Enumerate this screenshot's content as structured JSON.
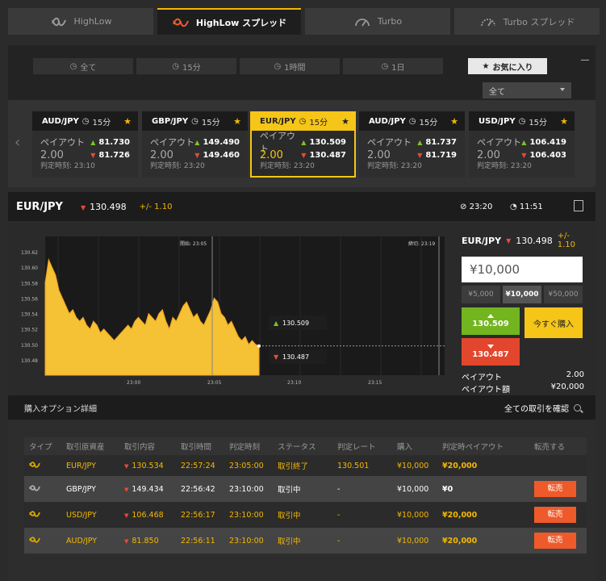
{
  "product_tabs": [
    {
      "label": "HighLow",
      "icon": "highlow-icon"
    },
    {
      "label": "HighLow スプレッド",
      "icon": "highlow-spread-icon"
    },
    {
      "label": "Turbo",
      "icon": "turbo-gauge-icon"
    },
    {
      "label": "Turbo スプレッド",
      "icon": "turbo-spread-gauge-icon"
    }
  ],
  "filter_tabs": [
    "全て",
    "15分",
    "1時間",
    "1日",
    "お気に入り"
  ],
  "filter_select": "全て",
  "cards": [
    {
      "pair": "AUD/JPY",
      "period": "15分",
      "payout_label": "ペイアウト",
      "payout": "2.00",
      "high": "81.730",
      "low": "81.726",
      "time_label": "判定時刻: 23:10"
    },
    {
      "pair": "GBP/JPY",
      "period": "15分",
      "payout_label": "ペイアウト",
      "payout": "2.00",
      "high": "149.490",
      "low": "149.460",
      "time_label": "判定時刻: 23:20"
    },
    {
      "pair": "EUR/JPY",
      "period": "15分",
      "payout_label": "ペイアウト",
      "payout": "2.00",
      "high": "130.509",
      "low": "130.487",
      "time_label": "判定時刻: 23:20"
    },
    {
      "pair": "AUD/JPY",
      "period": "15分",
      "payout_label": "ペイアウト",
      "payout": "2.00",
      "high": "81.737",
      "low": "81.719",
      "time_label": "判定時刻: 23:20"
    },
    {
      "pair": "USD/JPY",
      "period": "15分",
      "payout_label": "ペイアウト",
      "payout": "2.00",
      "high": "106.419",
      "low": "106.403",
      "time_label": "判定時刻: 23:20"
    }
  ],
  "asset": {
    "name": "EUR/JPY",
    "price": "130.498",
    "change": "+/- 1.10",
    "close_time": "23:20",
    "remaining": "11:51"
  },
  "chart_data": {
    "type": "area",
    "yticks": [
      "130.62",
      "130.60",
      "130.58",
      "130.56",
      "130.54",
      "130.52",
      "130.50",
      "130.48"
    ],
    "xticks": [
      "23:00",
      "23:05",
      "23:10",
      "23:15"
    ],
    "start_label": "開始: 23:05",
    "end_label": "締切: 23:19",
    "high_label": "130.509",
    "low_label": "130.487",
    "ylim": [
      130.46,
      130.64
    ],
    "values": [
      130.58,
      130.61,
      130.6,
      130.59,
      130.57,
      130.56,
      130.55,
      130.54,
      130.545,
      130.535,
      130.53,
      130.535,
      130.525,
      130.52,
      130.53,
      130.525,
      130.515,
      130.52,
      130.515,
      130.51,
      130.505,
      130.51,
      130.515,
      130.52,
      130.525,
      130.52,
      130.53,
      130.535,
      130.53,
      130.525,
      130.54,
      130.535,
      130.53,
      130.54,
      130.545,
      130.53,
      130.52,
      130.535,
      130.53,
      130.54,
      130.55,
      130.555,
      130.545,
      130.535,
      130.54,
      130.53,
      130.525,
      130.535,
      130.545,
      130.56,
      130.555,
      130.54,
      130.535,
      130.525,
      130.53,
      130.52,
      130.51,
      130.505,
      130.51,
      130.5,
      130.505,
      130.5,
      130.498
    ]
  },
  "side": {
    "pair": "EUR/JPY",
    "price": "130.498",
    "change": "+/- 1.10",
    "amount": "¥10,000",
    "quick": [
      "¥5,000",
      "¥10,000",
      "¥50,000"
    ],
    "high": "130.509",
    "low": "130.487",
    "buy_now": "今すぐ購入",
    "payout_label": "ペイアウト",
    "payout": "2.00",
    "payout_amount_label": "ペイアウト額",
    "payout_amount": "¥20,000"
  },
  "options": {
    "title": "購入オプション詳細",
    "view_all": "全ての取引を確認"
  },
  "table": {
    "headers": [
      "タイプ",
      "取引原資産",
      "取引内容",
      "取引時間",
      "判定時刻",
      "ステータス",
      "判定レート",
      "購入",
      "判定時ペイアウト",
      "転売する"
    ],
    "rows": [
      {
        "asset": "EUR/JPY",
        "rate": "130.534",
        "time": "22:57:24",
        "expiry": "23:05:00",
        "status": "取引終了",
        "settle": "130.501",
        "buy": "¥10,000",
        "payout": "¥20,000",
        "sell": ""
      },
      {
        "asset": "GBP/JPY",
        "rate": "149.434",
        "time": "22:56:42",
        "expiry": "23:10:00",
        "status": "取引中",
        "settle": "-",
        "buy": "¥10,000",
        "payout": "¥0",
        "sell": "転売"
      },
      {
        "asset": "USD/JPY",
        "rate": "106.468",
        "time": "22:56:17",
        "expiry": "23:10:00",
        "status": "取引中",
        "settle": "-",
        "buy": "¥10,000",
        "payout": "¥20,000",
        "sell": "転売"
      },
      {
        "asset": "AUD/JPY",
        "rate": "81.850",
        "time": "22:56:11",
        "expiry": "23:10:00",
        "status": "取引中",
        "settle": "-",
        "buy": "¥10,000",
        "payout": "¥20,000",
        "sell": "転売"
      }
    ]
  }
}
